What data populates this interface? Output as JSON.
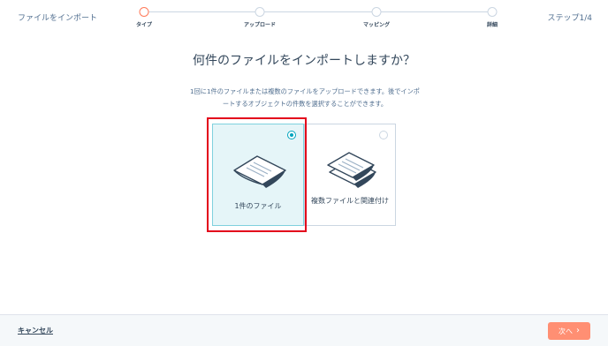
{
  "header": {
    "title": "ファイルをインポート",
    "step_counter": "ステップ1/4",
    "steps": [
      {
        "label": "タイプ",
        "active": true
      },
      {
        "label": "アップロード",
        "active": false
      },
      {
        "label": "マッピング",
        "active": false
      },
      {
        "label": "詳細",
        "active": false
      }
    ]
  },
  "main": {
    "heading": "何件のファイルをインポートしますか？",
    "description": "1回に1件のファイルまたは複数のファイルをアップロードできます。後でインポートするオブジェクトの件数を選択することができます。",
    "options": [
      {
        "label": "1件のファイル",
        "selected": true,
        "icon": "single-file-icon"
      },
      {
        "label": "複数ファイルと関連付け",
        "selected": false,
        "icon": "multiple-files-icon"
      }
    ]
  },
  "footer": {
    "cancel_label": "キャンセル",
    "next_label": "次へ",
    "next_icon": "chevron-right-icon"
  },
  "colors": {
    "accent": "#ff7a59",
    "next_button": "#ff8f73",
    "selected_card_bg": "#e5f5f8",
    "radio_selected": "#00a4bd",
    "highlight_border": "#e3001b"
  }
}
